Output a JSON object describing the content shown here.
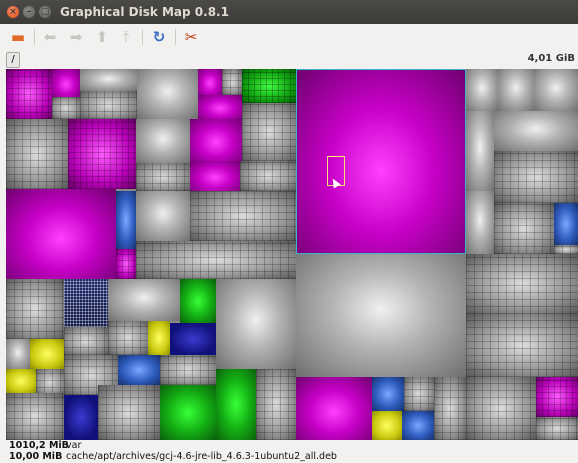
{
  "window": {
    "title": "Graphical Disk Map 0.8.1"
  },
  "toolbar": {
    "items": [
      {
        "icon": "open-folder-icon",
        "glyph": "▬",
        "enabled": true
      },
      {
        "icon": "back-arrow-icon",
        "glyph": "⬅",
        "enabled": false
      },
      {
        "icon": "forward-arrow-icon",
        "glyph": "➡",
        "enabled": false
      },
      {
        "icon": "up-arrow-icon",
        "glyph": "⬆",
        "enabled": false
      },
      {
        "icon": "top-level-icon",
        "glyph": "⤒",
        "enabled": false
      },
      {
        "icon": "refresh-icon",
        "glyph": "↻",
        "enabled": true
      },
      {
        "icon": "preferences-tools-icon",
        "glyph": "✂",
        "enabled": true
      }
    ]
  },
  "pathbar": {
    "root_label": "/",
    "total_size": "4,01 GiB"
  },
  "colors": {
    "magenta": "#c600c6",
    "gray": "#9a9a9a",
    "green": "#14b014",
    "blue": "#2e5bbd",
    "yellow": "#caca10",
    "selection": "#34b8c8"
  },
  "status": {
    "rows": [
      {
        "size": "1010,2 MiB",
        "path": "var"
      },
      {
        "size": "10,00 MiB",
        "path": "cache/apt/archives/gcj-4.6-jre-lib_4.6.3-1ubuntu2_all.deb"
      }
    ]
  }
}
